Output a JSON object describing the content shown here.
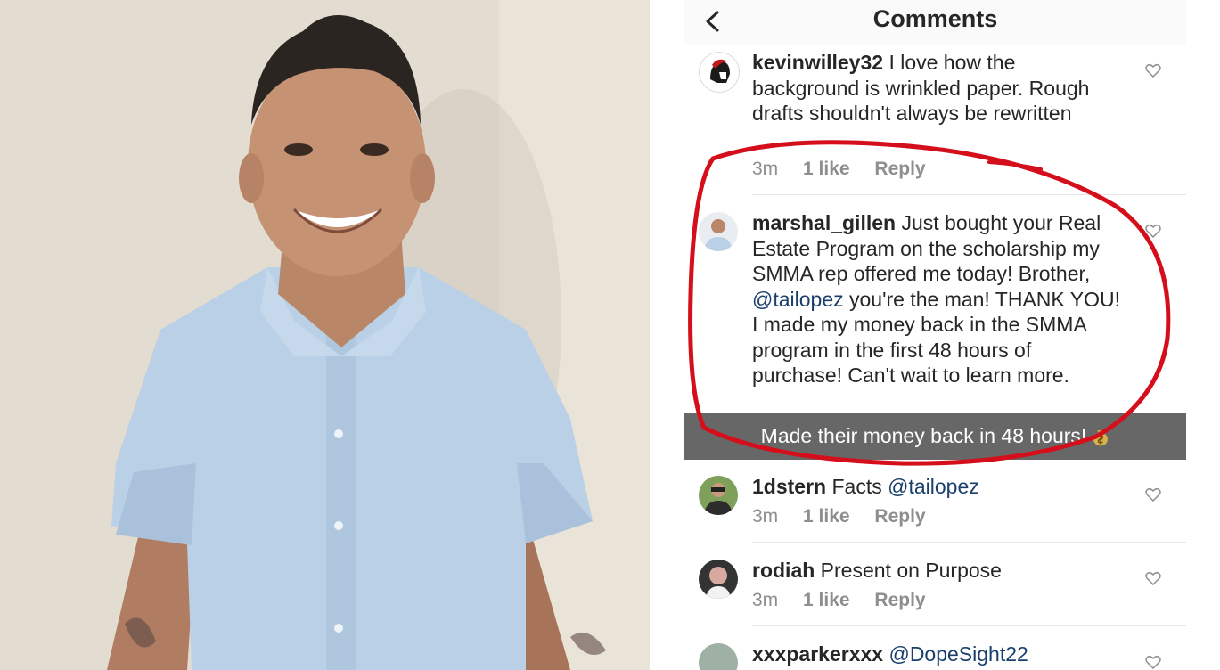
{
  "header": {
    "title": "Comments"
  },
  "comments": [
    {
      "username": "kevinwilley32",
      "text": "I love how the background is wrinkled paper. Rough drafts shouldn't always be rewritten",
      "time": "3m",
      "likes": "1 like",
      "reply": "Reply"
    },
    {
      "username": "marshal_gillen",
      "text_before": "Just bought your Real Estate Program on the scholarship my SMMA rep offered me today! Brother,",
      "mention": "@tailopez",
      "text_after": "you're the man! THANK YOU! I made my money back in the SMMA program in the first 48 hours of purchase! Can't wait to learn more."
    },
    {
      "username": "1dstern",
      "text": "Facts",
      "mention": "@tailopez",
      "time": "3m",
      "likes": "1 like",
      "reply": "Reply"
    },
    {
      "username": "rodiah",
      "text": "Present on Purpose",
      "time": "3m",
      "likes": "1 like",
      "reply": "Reply"
    },
    {
      "username": "xxxparkerxxx",
      "mention": "@DopeSight22"
    }
  ],
  "overlay": {
    "caption": "Made their money back in 48 hours!"
  },
  "colors": {
    "annotation": "#d40f1b",
    "mention": "#1a3f6b",
    "meta": "#8e8e8e"
  }
}
